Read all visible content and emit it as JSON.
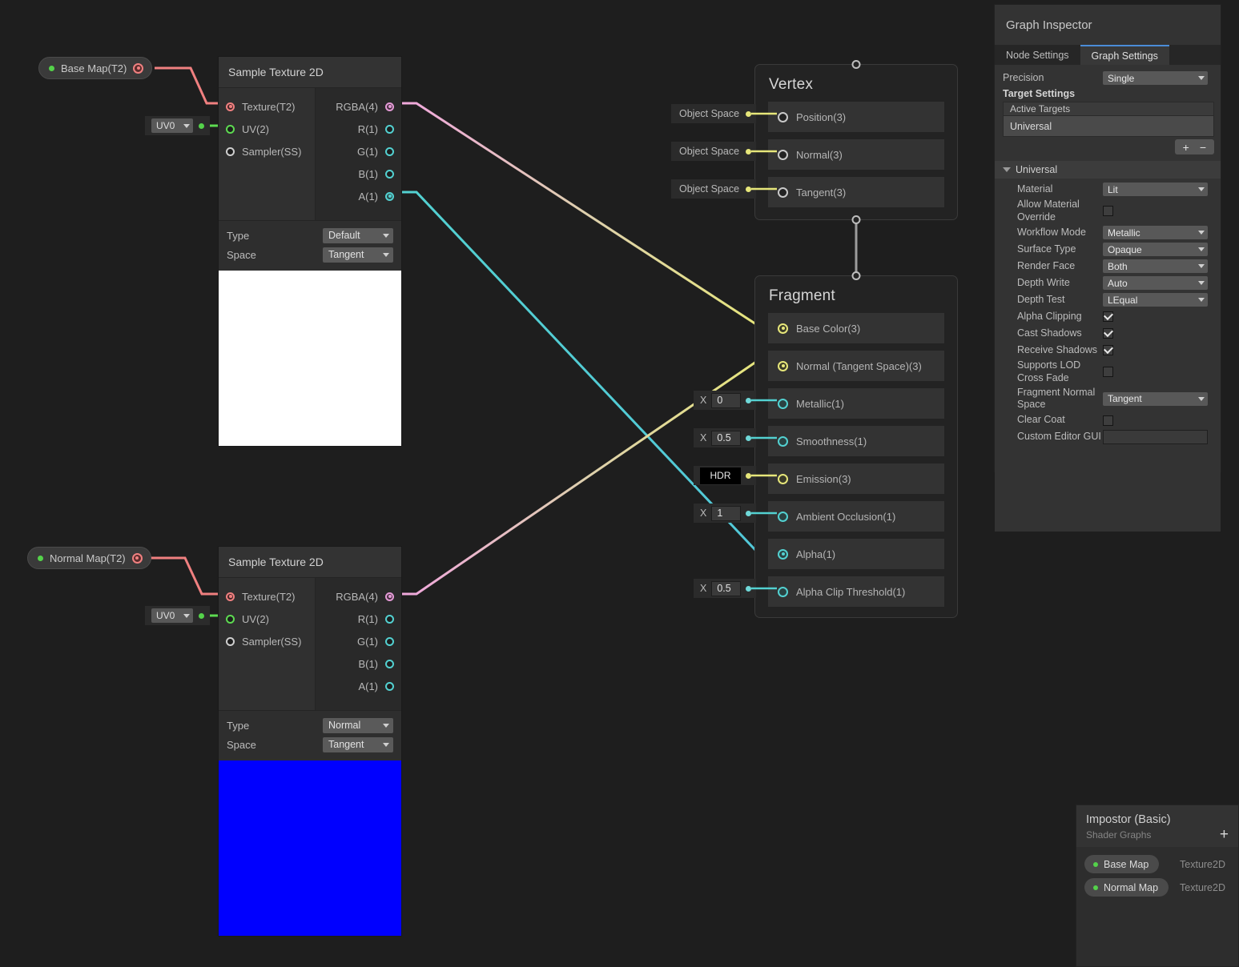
{
  "properties": [
    {
      "name": "base_map_pill",
      "label": "Base Map(T2)"
    },
    {
      "name": "normal_map_pill",
      "label": "Normal Map(T2)"
    }
  ],
  "uv_widgets": [
    {
      "value": "UV0"
    },
    {
      "value": "UV0"
    }
  ],
  "sample_nodes": [
    {
      "title": "Sample Texture 2D",
      "inputs": [
        "Texture(T2)",
        "UV(2)",
        "Sampler(SS)"
      ],
      "outputs": [
        "RGBA(4)",
        "R(1)",
        "G(1)",
        "B(1)",
        "A(1)"
      ],
      "props": [
        {
          "label": "Type",
          "value": "Default"
        },
        {
          "label": "Space",
          "value": "Tangent"
        }
      ],
      "preview_color": "#ffffff"
    },
    {
      "title": "Sample Texture 2D",
      "inputs": [
        "Texture(T2)",
        "UV(2)",
        "Sampler(SS)"
      ],
      "outputs": [
        "RGBA(4)",
        "R(1)",
        "G(1)",
        "B(1)",
        "A(1)"
      ],
      "props": [
        {
          "label": "Type",
          "value": "Normal"
        },
        {
          "label": "Space",
          "value": "Tangent"
        }
      ],
      "preview_color": "#0000ff"
    }
  ],
  "vertex": {
    "title": "Vertex",
    "rows": [
      {
        "label": "Position(3)",
        "widget": "Object Space"
      },
      {
        "label": "Normal(3)",
        "widget": "Object Space"
      },
      {
        "label": "Tangent(3)",
        "widget": "Object Space"
      }
    ]
  },
  "fragment": {
    "title": "Fragment",
    "rows": [
      {
        "label": "Base Color(3)",
        "widget": null,
        "connected": true
      },
      {
        "label": "Normal (Tangent Space)(3)",
        "widget": null,
        "connected": true
      },
      {
        "label": "Metallic(1)",
        "widget": "0",
        "connected": false
      },
      {
        "label": "Smoothness(1)",
        "widget": "0.5",
        "connected": false
      },
      {
        "label": "Emission(3)",
        "widget": "HDR",
        "connected": false
      },
      {
        "label": "Ambient Occlusion(1)",
        "widget": "1",
        "connected": false
      },
      {
        "label": "Alpha(1)",
        "widget": null,
        "connected": true
      },
      {
        "label": "Alpha Clip Threshold(1)",
        "widget": "0.5",
        "connected": false
      }
    ],
    "axis_label": "X"
  },
  "inspector": {
    "title": "Graph Inspector",
    "tabs": [
      {
        "label": "Node Settings",
        "active": false
      },
      {
        "label": "Graph Settings",
        "active": true
      }
    ],
    "precision": {
      "label": "Precision",
      "value": "Single"
    },
    "target_settings_label": "Target Settings",
    "active_targets_label": "Active Targets",
    "active_targets": [
      "Universal"
    ],
    "add_button": "+",
    "remove_button": "−",
    "foldout_label": "Universal",
    "settings": [
      {
        "label": "Material",
        "type": "dropdown",
        "value": "Lit"
      },
      {
        "label": "Allow Material Override",
        "type": "checkbox",
        "checked": false
      },
      {
        "label": "Workflow Mode",
        "type": "dropdown",
        "value": "Metallic"
      },
      {
        "label": "Surface Type",
        "type": "dropdown",
        "value": "Opaque"
      },
      {
        "label": "Render Face",
        "type": "dropdown",
        "value": "Both"
      },
      {
        "label": "Depth Write",
        "type": "dropdown",
        "value": "Auto"
      },
      {
        "label": "Depth Test",
        "type": "dropdown",
        "value": "LEqual"
      },
      {
        "label": "Alpha Clipping",
        "type": "checkbox",
        "checked": true
      },
      {
        "label": "Cast Shadows",
        "type": "checkbox",
        "checked": true
      },
      {
        "label": "Receive Shadows",
        "type": "checkbox",
        "checked": true
      },
      {
        "label": "Supports LOD Cross Fade",
        "type": "checkbox",
        "checked": false
      },
      {
        "label": "Fragment Normal Space",
        "type": "dropdown",
        "value": "Tangent"
      },
      {
        "label": "Clear Coat",
        "type": "checkbox",
        "checked": false
      },
      {
        "label": "Custom Editor GUI",
        "type": "text",
        "value": ""
      }
    ]
  },
  "blackboard": {
    "title": "Impostor (Basic)",
    "subtitle": "Shader Graphs",
    "add_button": "+",
    "items": [
      {
        "name": "Base Map",
        "type": "Texture2D"
      },
      {
        "name": "Normal Map",
        "type": "Texture2D"
      }
    ]
  },
  "colors": {
    "background": "#1e1e1e",
    "texture_port": "#f08080",
    "uv_port": "#5ddb51",
    "vector_port": "#53d1d1",
    "color_port": "#e39ad6",
    "vec3_port": "#e6e67a",
    "tab_accent": "#4a8cd8"
  }
}
